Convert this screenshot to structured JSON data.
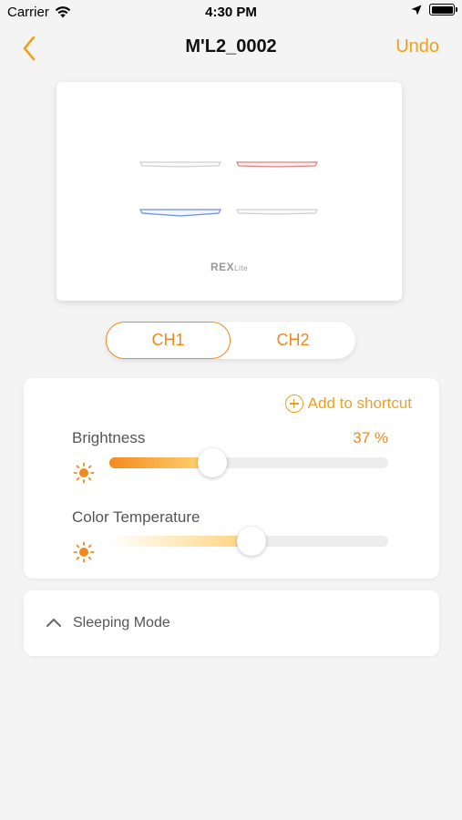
{
  "status_bar": {
    "carrier": "Carrier",
    "time": "4:30 PM"
  },
  "nav": {
    "title": "M'L2_0002",
    "undo_label": "Undo",
    "back_icon": "chevron-left-icon"
  },
  "preview": {
    "brand": "REX",
    "brand_sub": "Lite"
  },
  "channels": {
    "items": [
      "CH1",
      "CH2"
    ],
    "selected": "CH1"
  },
  "controls": {
    "add_shortcut_label": "Add to shortcut",
    "brightness": {
      "label": "Brightness",
      "value_text": "37 %",
      "value": 0.37
    },
    "color_temperature": {
      "label": "Color Temperature",
      "value": 0.51
    }
  },
  "sleeping_mode": {
    "label": "Sleeping Mode"
  },
  "colors": {
    "accent": "#f0a020",
    "orange": "#ef8a1c"
  }
}
